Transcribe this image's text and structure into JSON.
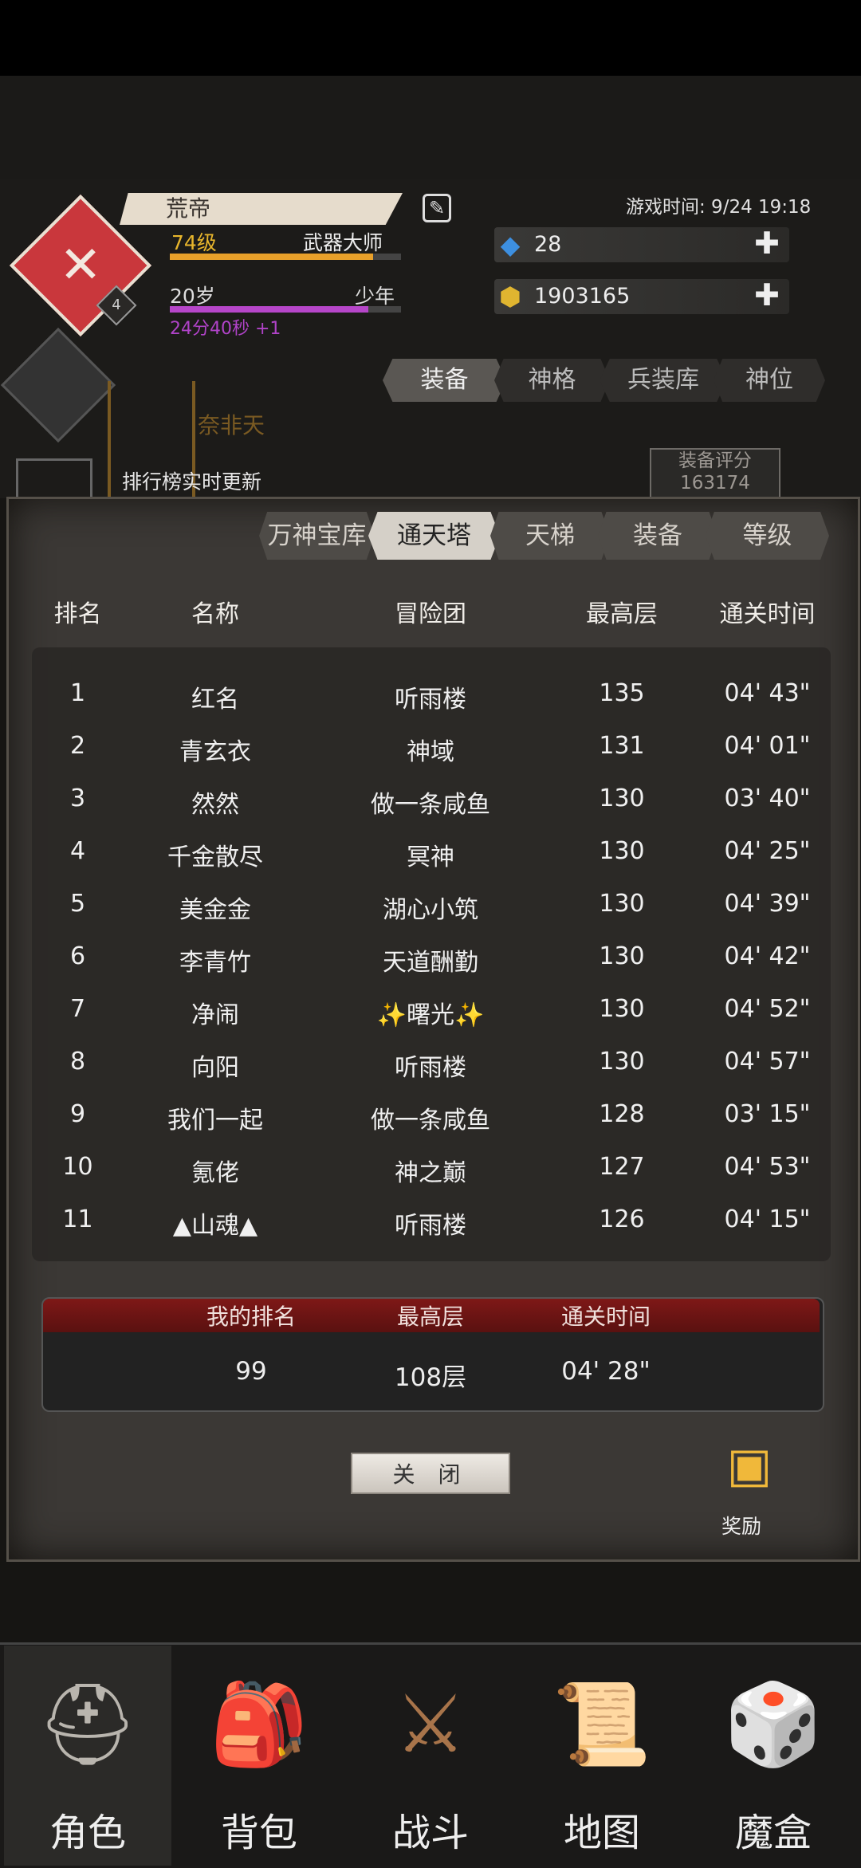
{
  "player": {
    "name": "荒帝",
    "level": "74级",
    "title": "武器大师",
    "age": "20岁",
    "stage": "少年",
    "timer": "24分40秒 +1",
    "emblem_badge": "4",
    "game_time": "游戏时间: 9/24 19:18"
  },
  "currency": {
    "gems": "28",
    "gold": "1903165"
  },
  "top_tabs": [
    "装备",
    "神格",
    "兵装库",
    "神位"
  ],
  "character": {
    "name": "奈非天",
    "rank_note": "排行榜实时更新",
    "score_label": "装备评分",
    "score_value": "163174"
  },
  "rank_tabs": [
    "万神宝库",
    "通天塔",
    "天梯",
    "装备",
    "等级"
  ],
  "table": {
    "headers": [
      "排名",
      "名称",
      "冒险团",
      "最高层",
      "通关时间"
    ],
    "rows": [
      {
        "rank": "1",
        "name": "红名",
        "guild": "听雨楼",
        "floor": "135",
        "time": "04' 43\""
      },
      {
        "rank": "2",
        "name": "青玄衣",
        "guild": "神域",
        "floor": "131",
        "time": "04' 01\""
      },
      {
        "rank": "3",
        "name": "然然",
        "guild": "做一条咸鱼",
        "floor": "130",
        "time": "03' 40\""
      },
      {
        "rank": "4",
        "name": "千金散尽",
        "guild": "冥神",
        "floor": "130",
        "time": "04' 25\""
      },
      {
        "rank": "5",
        "name": "美金金",
        "guild": "湖心小筑",
        "floor": "130",
        "time": "04' 39\""
      },
      {
        "rank": "6",
        "name": "李青竹",
        "guild": "天道酬勤",
        "floor": "130",
        "time": "04' 42\""
      },
      {
        "rank": "7",
        "name": "净闹",
        "guild": "✨曙光✨",
        "floor": "130",
        "time": "04' 52\""
      },
      {
        "rank": "8",
        "name": "向阳",
        "guild": "听雨楼",
        "floor": "130",
        "time": "04' 57\""
      },
      {
        "rank": "9",
        "name": "我们一起",
        "guild": "做一条咸鱼",
        "floor": "128",
        "time": "03' 15\""
      },
      {
        "rank": "10",
        "name": "氪佬",
        "guild": "神之巅",
        "floor": "127",
        "time": "04' 53\""
      },
      {
        "rank": "11",
        "name": "▲山魂▲",
        "guild": "听雨楼",
        "floor": "126",
        "time": "04' 15\""
      }
    ]
  },
  "my_rank": {
    "headers": [
      "我的排名",
      "最高层",
      "通关时间"
    ],
    "rank": "99",
    "floor": "108层",
    "time": "04' 28\""
  },
  "close_label": "关 闭",
  "reward_label": "奖励",
  "nav": [
    "角色",
    "背包",
    "战斗",
    "地图",
    "魔盒"
  ]
}
